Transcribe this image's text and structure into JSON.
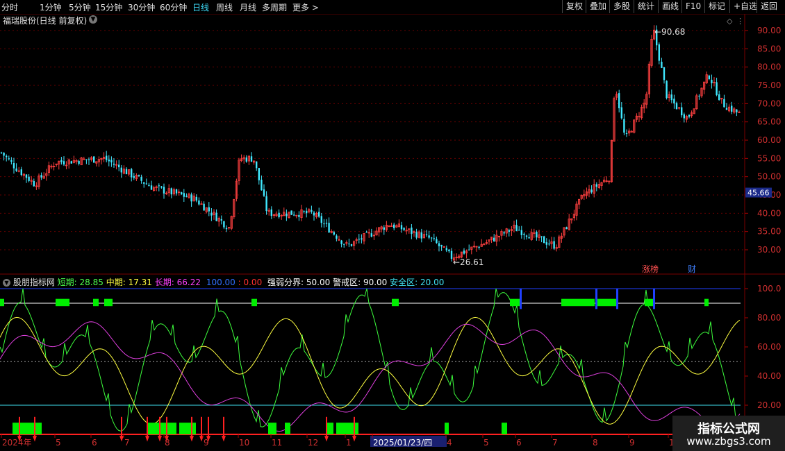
{
  "toolbar": {
    "tabs": [
      "分时",
      "1分钟",
      "5分钟",
      "15分钟",
      "30分钟",
      "60分钟",
      "日线",
      "周线",
      "月线",
      "多周期",
      "更多 >"
    ],
    "active_tab": "日线",
    "right_buttons": [
      "复权",
      "叠加",
      "多股",
      "统计",
      "画线",
      "F10",
      "标记",
      "+自选",
      "返回"
    ]
  },
  "stock_title": "福瑞股份(日线 前复权)",
  "price_axis": [
    "90.00",
    "85.00",
    "80.00",
    "75.00",
    "70.00",
    "65.00",
    "60.00",
    "55.00",
    "50.00",
    "45.00",
    "40.00",
    "35.00",
    "30.00"
  ],
  "current_price": "45.66",
  "high_label": "90.68",
  "low_label": "26.61",
  "event_tags": [
    "涨榜",
    "财"
  ],
  "indicator": {
    "name": "股朋指标网",
    "short_label": "短期: ",
    "short_value": "28.85",
    "mid_label": "中期: ",
    "mid_value": "17.31",
    "long_label": "长期: ",
    "long_value": "66.22",
    "v100": "100.00",
    "sep": " : ",
    "v0": "0.00",
    "boundary_label": "强弱分界: ",
    "boundary_value": "50.00",
    "warn_label": "警戒区: ",
    "warn_value": "90.00",
    "safe_label": "安全区: ",
    "safe_value": "20.00",
    "axis": [
      "100.0",
      "80.00",
      "60.00",
      "40.00",
      "20.00"
    ]
  },
  "date_axis": [
    "2024年",
    "5",
    "6",
    "7",
    "8",
    "9",
    "10",
    "11",
    "12",
    "1",
    "2025/01/23/四",
    "4",
    "5",
    "6",
    "7",
    "8",
    "9",
    "10"
  ],
  "chart_data": {
    "type": "candlestick",
    "y_range": [
      26,
      94
    ],
    "indicator_range": [
      0,
      100
    ],
    "indicator_levels": {
      "warning": 90,
      "boundary": 50,
      "safe": 20
    },
    "price_keypoints": [
      [
        0,
        57
      ],
      [
        20,
        53
      ],
      [
        50,
        48
      ],
      [
        80,
        54
      ],
      [
        150,
        55
      ],
      [
        220,
        47
      ],
      [
        280,
        44
      ],
      [
        330,
        36
      ],
      [
        345,
        55
      ],
      [
        365,
        55
      ],
      [
        385,
        40
      ],
      [
        450,
        40
      ],
      [
        500,
        31
      ],
      [
        560,
        37
      ],
      [
        620,
        33
      ],
      [
        650,
        28
      ],
      [
        700,
        32
      ],
      [
        740,
        36
      ],
      [
        800,
        31
      ],
      [
        840,
        45
      ],
      [
        878,
        50
      ],
      [
        885,
        76
      ],
      [
        900,
        60
      ],
      [
        930,
        71
      ],
      [
        940,
        91
      ],
      [
        960,
        72
      ],
      [
        990,
        66
      ],
      [
        1020,
        78
      ],
      [
        1040,
        70
      ],
      [
        1066,
        67
      ]
    ],
    "colors": {
      "up": "#ff4040",
      "down": "#40e8ff",
      "short": "#3dff3d",
      "mid": "#ffff40",
      "long": "#e040e0",
      "safe_line": "#40e0f0",
      "warn_line": "#ffffff",
      "bars": "#00ee00"
    }
  },
  "watermark": {
    "title": "指标公式网",
    "url": "www.zbgs3.com"
  },
  "colors": {
    "short": "#4dff4d",
    "mid": "#ffff40",
    "long": "#ff40ff",
    "blue": "#3070ff",
    "red": "#ff3030",
    "cyan": "#40e0f0",
    "tag_red": "#ff5050",
    "tag_blue": "#4080ff"
  }
}
